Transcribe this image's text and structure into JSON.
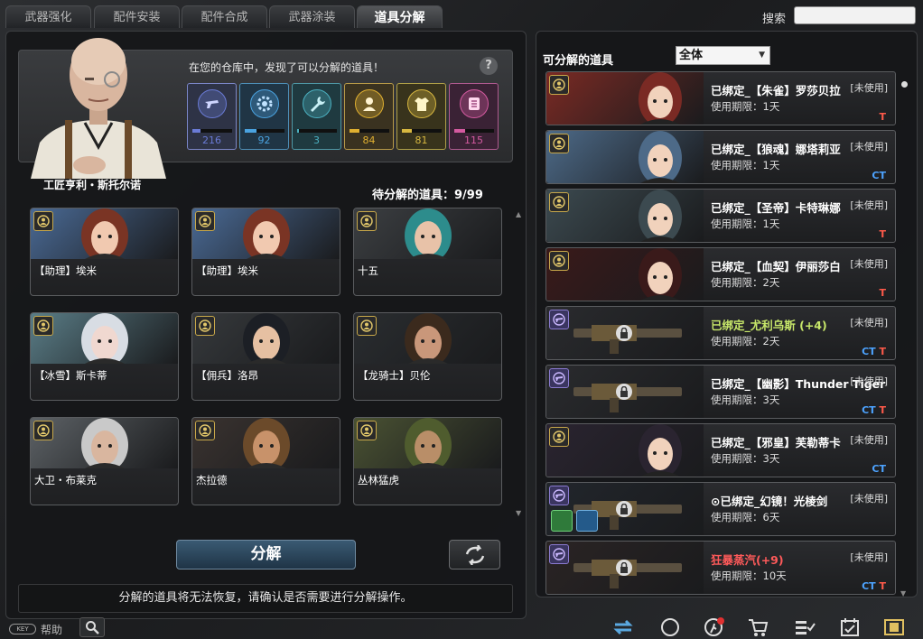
{
  "tabs": [
    {
      "label": "武器强化"
    },
    {
      "label": "配件安装"
    },
    {
      "label": "配件合成"
    },
    {
      "label": "武器涂装"
    },
    {
      "label": "道具分解"
    }
  ],
  "search": {
    "label": "搜索",
    "value": ""
  },
  "npc": {
    "name": "工匠亨利・斯托尔诺",
    "message": "在您的仓库中，发现了可以分解的道具！",
    "help_icon": "question-icon"
  },
  "stats": [
    {
      "icon": "gun-icon",
      "value": "216",
      "color": "#6a7bd6",
      "fill": 0.2,
      "bg": "#2e3346",
      "border": "#7b86c8"
    },
    {
      "icon": "gear-icon",
      "value": "92",
      "color": "#4aa3e0",
      "fill": 0.3,
      "bg": "#203545",
      "border": "#4e8fb8"
    },
    {
      "icon": "wrench-icon",
      "value": "3",
      "color": "#4bb0c0",
      "fill": 0.05,
      "bg": "#1f3a40",
      "border": "#4f98a6"
    },
    {
      "icon": "character-icon",
      "value": "84",
      "color": "#e0b030",
      "fill": 0.25,
      "bg": "#3a3220",
      "border": "#b89a48"
    },
    {
      "icon": "shirt-icon",
      "value": "81",
      "color": "#d8b840",
      "fill": 0.24,
      "bg": "#38331c",
      "border": "#b0a048"
    },
    {
      "icon": "scroll-icon",
      "value": "115",
      "color": "#d45aa0",
      "fill": 0.28,
      "bg": "#3a2235",
      "border": "#b05a90"
    }
  ],
  "pending": {
    "label": "待分解的道具：9/99"
  },
  "cards": [
    {
      "label": "【助理】埃米",
      "bg": "#4a6a95",
      "hair": "#7a3424",
      "skin": "#f1c9b0"
    },
    {
      "label": "【助理】埃米",
      "bg": "#4a6a95",
      "hair": "#7a3424",
      "skin": "#f1c9b0"
    },
    {
      "label": "十五",
      "bg": "#3c3f42",
      "hair": "#2d8c8c",
      "skin": "#e8c2a8"
    },
    {
      "label": "【冰雪】斯卡蒂",
      "bg": "#5a7d87",
      "hair": "#d8dde4",
      "skin": "#f0d8d0"
    },
    {
      "label": "【佣兵】洛昂",
      "bg": "#36393c",
      "hair": "#1c1f25",
      "skin": "#e6c0a2"
    },
    {
      "label": "【龙骑士】贝伦",
      "bg": "#2a2d30",
      "hair": "#3b2a1d",
      "skin": "#c9977a"
    },
    {
      "label": "大卫・布莱克",
      "bg": "#5d6266",
      "hair": "#c9c9c9",
      "skin": "#d9b69f"
    },
    {
      "label": "杰拉德",
      "bg": "#3a3330",
      "hair": "#6b4a2a",
      "skin": "#c8926a"
    },
    {
      "label": "丛林猛虎",
      "bg": "#4a5233",
      "hair": "#4f5c2e",
      "skin": "#b98e68"
    }
  ],
  "buttons": {
    "split": "分解"
  },
  "warning": "分解的道具将无法恢复，请确认是否需要进行分解操作。",
  "help": {
    "label": "帮助",
    "pill": "KEY"
  },
  "right": {
    "title": "可分解的道具",
    "filter": "全体",
    "items": [
      {
        "name": "已绑定_【朱雀】罗莎贝拉",
        "status": "[未使用]",
        "duration": "使用期限：1天",
        "ct": "",
        "t": "T",
        "type": "character",
        "name_color": "#ffffff",
        "bg": "#7a2a24"
      },
      {
        "name": "已绑定_【狼魂】娜塔莉亚",
        "status": "[未使用]",
        "duration": "使用期限：1天",
        "ct": "CT",
        "t": "",
        "type": "character",
        "name_color": "#ffffff",
        "bg": "#4d6a88"
      },
      {
        "name": "已绑定_【圣帝】卡特琳娜",
        "status": "[未使用]",
        "duration": "使用期限：1天",
        "ct": "",
        "t": "T",
        "type": "character",
        "name_color": "#ffffff",
        "bg": "#3c4a50"
      },
      {
        "name": "已绑定_【血契】伊丽莎白",
        "status": "[未使用]",
        "duration": "使用期限：2天",
        "ct": "",
        "t": "T",
        "type": "character",
        "name_color": "#ffffff",
        "bg": "#3a1a1a"
      },
      {
        "name": "已绑定_尤利乌斯 (+4)",
        "status": "[未使用]",
        "duration": "使用期限：2天",
        "ct": "CT",
        "t": "T",
        "type": "weapon",
        "name_color": "#c8e86a",
        "bg": "#2a2b2e"
      },
      {
        "name": "已绑定_【幽影】Thunder Tiger",
        "status": "[未使用]",
        "duration": "使用期限：3天",
        "ct": "CT",
        "t": "T",
        "type": "weapon",
        "name_color": "#ffffff",
        "bg": "#2a2b2e"
      },
      {
        "name": "已绑定_【邪皇】芙勒蒂卡",
        "status": "[未使用]",
        "duration": "使用期限：3天",
        "ct": "CT",
        "t": "",
        "type": "character",
        "name_color": "#ffffff",
        "bg": "#2a2430"
      },
      {
        "name": "已绑定_幻镜！光棱剑",
        "status": "[未使用]",
        "duration": "使用期限：6天",
        "ct": "",
        "t": "",
        "type": "weapon",
        "name_color": "#ffffff",
        "bg": "#22262c",
        "prefix": "⊙"
      },
      {
        "name": "狂暴蒸汽(+9)",
        "status": "[未使用]",
        "duration": "使用期限：10天",
        "ct": "CT",
        "t": "T",
        "type": "weapon",
        "name_color": "#ff5a5a",
        "bg": "#2a2424"
      }
    ]
  },
  "bottom_icons": [
    "swap-icon",
    "compass-icon",
    "runner-alert-icon",
    "cart-icon",
    "list-check-icon",
    "calendar-check-icon",
    "film-icon"
  ],
  "colors": {
    "accent": "#4a6f8f",
    "ct": "#4da3ff",
    "t": "#ff5a4a",
    "gold": "#c8a84a"
  }
}
